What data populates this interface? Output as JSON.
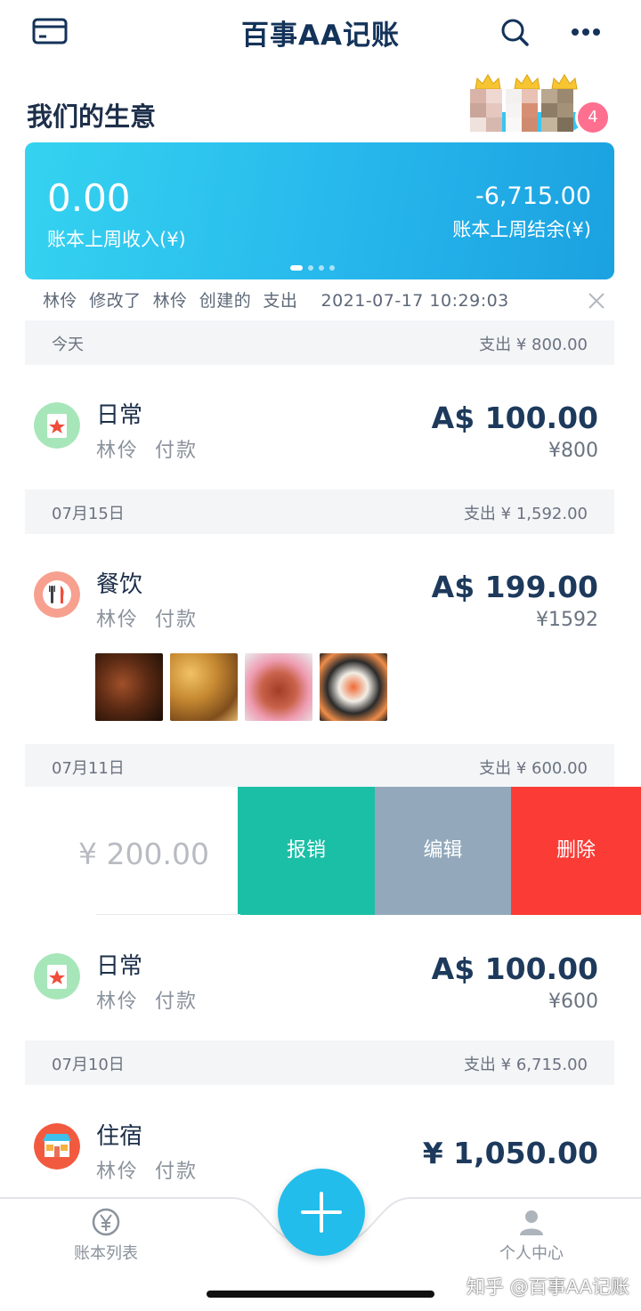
{
  "header": {
    "title": "百事AA记账",
    "card_icon": "card-icon",
    "search_icon": "search-icon",
    "more_icon": "more-icon"
  },
  "ledger": {
    "name": "我们的生意",
    "member_count": "4"
  },
  "summary": {
    "income": "0.00",
    "income_label": "账本上周收入(¥)",
    "balance": "-6,715.00",
    "balance_label": "账本上周结余(¥)",
    "page_dots": 4,
    "active_dot": 0
  },
  "notice": {
    "text": "林伶  修改了  林伶  创建的  支出    2021-07-17 10:29:03",
    "close_icon": "close-icon"
  },
  "days": [
    {
      "date": "今天",
      "total": "支出 ¥ 800.00"
    },
    {
      "date": "07月15日",
      "total": "支出 ¥ 1,592.00"
    },
    {
      "date": "07月11日",
      "total": "支出 ¥ 600.00"
    },
    {
      "date": "07月10日",
      "total": "支出 ¥ 6,715.00"
    }
  ],
  "entries": [
    {
      "category": "日常",
      "payer": "林伶  付款",
      "amount": "A$ 100.00",
      "cny": "¥800",
      "icon": "star-card-icon"
    },
    {
      "category": "餐饮",
      "payer": "林伶  付款",
      "amount": "A$ 199.00",
      "cny": "¥1592",
      "icon": "fork-knife-icon"
    },
    {
      "category": "日常",
      "payer": "林伶  付款",
      "amount": "A$ 100.00",
      "cny": "¥600",
      "icon": "star-card-icon"
    },
    {
      "category": "住宿",
      "payer": "林伶  付款",
      "amount": "¥ 1,050.00",
      "cny": "",
      "icon": "hotel-icon"
    }
  ],
  "photos": [
    "food-photo-1",
    "food-photo-2",
    "food-photo-3",
    "food-photo-4"
  ],
  "swiped": {
    "amount": "¥ 200.00",
    "actions": [
      "报销",
      "编辑",
      "删除"
    ],
    "colors": [
      "#1bbfa6",
      "#93a9bb",
      "#fb3b35"
    ]
  },
  "nav": {
    "left_label": "账本列表",
    "right_label": "个人中心",
    "add_icon": "plus-icon"
  },
  "watermark": "知乎 @百事AA记账",
  "colors": {
    "accent": "#22bdeb",
    "title": "#14335a",
    "daily_icon": "#a7e6b9",
    "food_icon": "#f7a08f",
    "hotel_icon": "#f25a3f"
  }
}
